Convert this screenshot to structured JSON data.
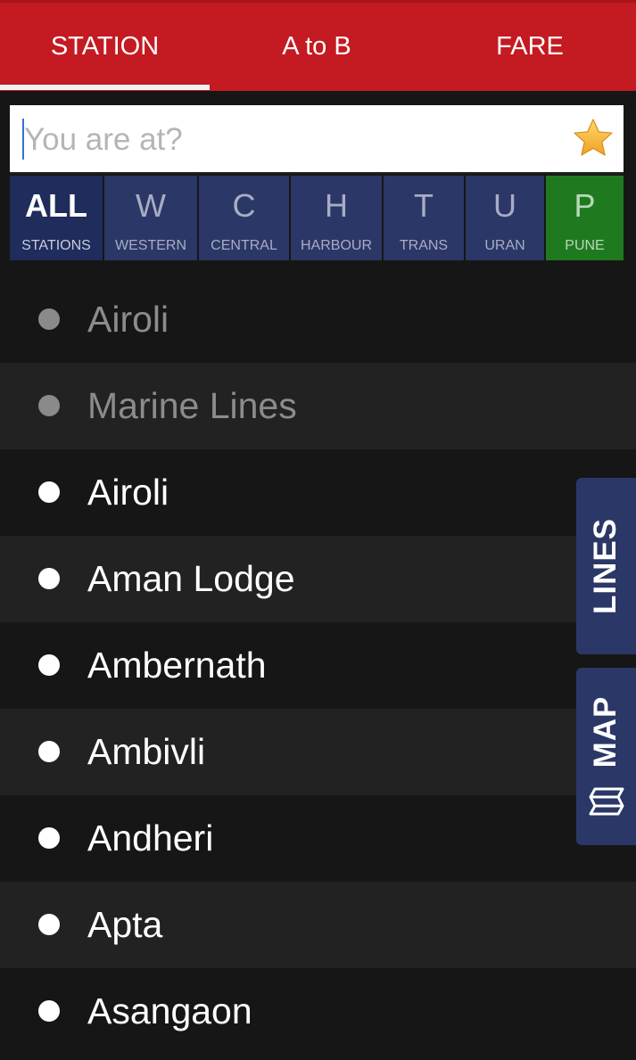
{
  "tabs": [
    {
      "label": "STATION"
    },
    {
      "label": "A to B"
    },
    {
      "label": "FARE"
    }
  ],
  "search": {
    "placeholder": "You are at?",
    "value": ""
  },
  "filters": [
    {
      "letter": "ALL",
      "sub": "STATIONS"
    },
    {
      "letter": "W",
      "sub": "WESTERN"
    },
    {
      "letter": "C",
      "sub": "CENTRAL"
    },
    {
      "letter": "H",
      "sub": "HARBOUR"
    },
    {
      "letter": "T",
      "sub": "TRANS"
    },
    {
      "letter": "U",
      "sub": "URAN"
    },
    {
      "letter": "P",
      "sub": "PUNE"
    }
  ],
  "recent": [
    {
      "name": "Airoli"
    },
    {
      "name": "Marine Lines"
    }
  ],
  "stations": [
    {
      "name": "Airoli"
    },
    {
      "name": "Aman Lodge"
    },
    {
      "name": "Ambernath"
    },
    {
      "name": "Ambivli"
    },
    {
      "name": "Andheri"
    },
    {
      "name": "Apta"
    },
    {
      "name": "Asangaon"
    }
  ],
  "side": {
    "lines_label": "LINES",
    "map_label": "MAP"
  },
  "colors": {
    "header": "#c41a22",
    "filter_bg": "#2b3766",
    "pune": "#1f7a1f",
    "star": "#f4b23a"
  },
  "icons": {
    "favorite": "star-icon",
    "map": "map-icon"
  }
}
